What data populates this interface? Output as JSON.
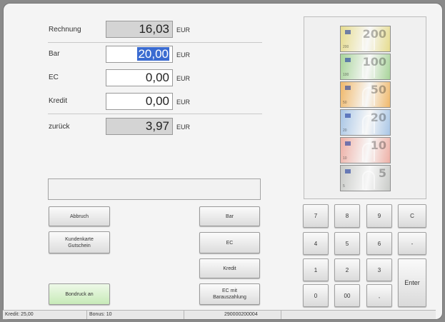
{
  "invoice": {
    "rechnung": {
      "label": "Rechnung",
      "value": "16,03",
      "unit": "EUR"
    },
    "bar": {
      "label": "Bar",
      "value": "20,00",
      "unit": "EUR"
    },
    "ec": {
      "label": "EC",
      "value": "0,00",
      "unit": "EUR"
    },
    "kredit": {
      "label": "Kredit",
      "value": "0,00",
      "unit": "EUR"
    },
    "zurueck": {
      "label": "zurück",
      "value": "3,97",
      "unit": "EUR"
    }
  },
  "buttons": {
    "abbruch": "Abbruch",
    "kundenkarte_line1": "Kundenkarte",
    "kundenkarte_line2": "Gutschein",
    "bondruck": "Bondruck an",
    "bar": "Bar",
    "ec": "EC",
    "kredit": "Kredit",
    "ec_mit_line1": "EC mit",
    "ec_mit_line2": "Barauszahlung"
  },
  "bills": [
    {
      "denomination": "200",
      "color": "#e6dc8e"
    },
    {
      "denomination": "100",
      "color": "#a8d49a"
    },
    {
      "denomination": "50",
      "color": "#f0b86a"
    },
    {
      "denomination": "20",
      "color": "#a9c6e6"
    },
    {
      "denomination": "10",
      "color": "#eeb0a6"
    },
    {
      "denomination": "5",
      "color": "#c9cbc8"
    }
  ],
  "keypad": {
    "k7": "7",
    "k8": "8",
    "k9": "9",
    "kc": "C",
    "k4": "4",
    "k5": "5",
    "k6": "6",
    "kminus": "-",
    "k1": "1",
    "k2": "2",
    "k3": "3",
    "enter": "Enter",
    "k0": "0",
    "k00": "00",
    "kcomma": ","
  },
  "status": {
    "kredit": "Kredit: 25,00",
    "bonus": "Bonus: 10",
    "number": "290000200004"
  }
}
